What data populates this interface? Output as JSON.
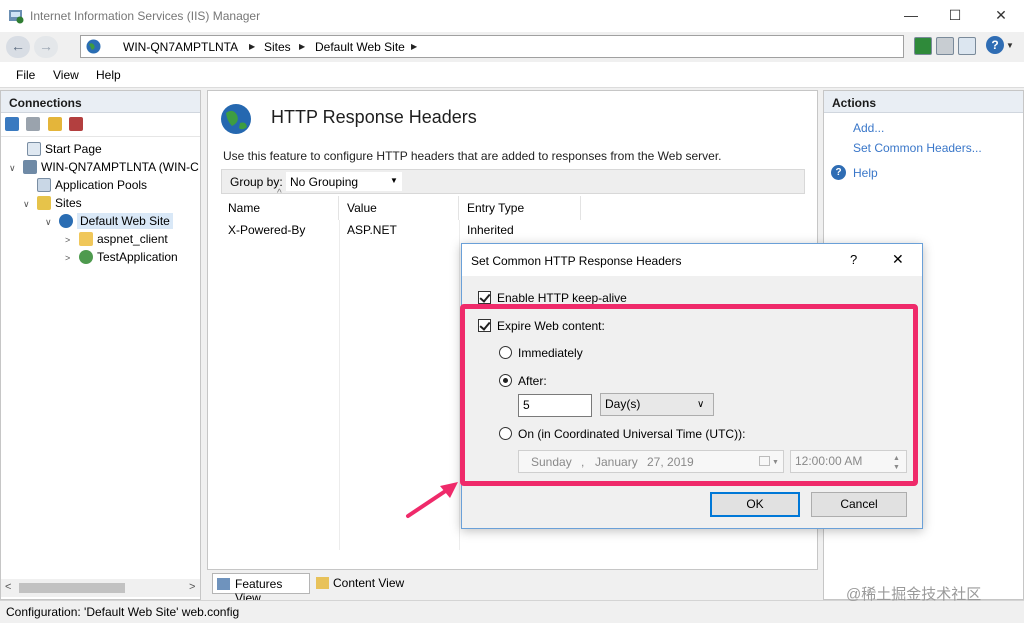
{
  "window": {
    "title": "Internet Information Services (IIS) Manager",
    "controls": {
      "minimize": "—",
      "maximize": "☐",
      "close": "✕"
    }
  },
  "address": {
    "back": "←",
    "forward": "→",
    "crumbs": [
      "WIN-QN7AMPTLNTA",
      "Sites",
      "Default Web Site"
    ],
    "separator": "▶",
    "help": "?"
  },
  "menu": {
    "items": [
      "File",
      "View",
      "Help"
    ]
  },
  "connections": {
    "title": "Connections",
    "tree": [
      {
        "label": "Start Page",
        "level": 0,
        "icon": "start-page-icon"
      },
      {
        "label": "WIN-QN7AMPTLNTA (WIN-C",
        "level": 0,
        "icon": "server-icon",
        "expander": "∨"
      },
      {
        "label": "Application Pools",
        "level": 1,
        "icon": "app-pool-icon"
      },
      {
        "label": "Sites",
        "level": 1,
        "icon": "sites-icon",
        "expander": "∨"
      },
      {
        "label": "Default Web Site",
        "level": 2,
        "icon": "globe-icon",
        "expander": "∨",
        "selected": true
      },
      {
        "label": "aspnet_client",
        "level": 3,
        "icon": "folder-icon",
        "expander": ">"
      },
      {
        "label": "TestApplication",
        "level": 3,
        "icon": "application-icon",
        "expander": ">"
      }
    ],
    "scroll_left": "<",
    "scroll_right": ">"
  },
  "feature": {
    "title": "HTTP Response Headers",
    "description": "Use this feature to configure HTTP headers that are added to responses from the Web server.",
    "group_by_label": "Group by:",
    "group_by_value": "No Grouping",
    "columns": [
      "Name",
      "Value",
      "Entry Type"
    ],
    "rows": [
      {
        "name": "X-Powered-By",
        "value": "ASP.NET",
        "entry_type": "Inherited"
      }
    ],
    "tabs": {
      "features_view": "Features View",
      "content_view": "Content View"
    }
  },
  "actions": {
    "title": "Actions",
    "add": "Add...",
    "set_common": "Set Common Headers...",
    "help": "Help"
  },
  "status": {
    "text": "Configuration: 'Default Web Site' web.config",
    "watermark": "@稀土掘金技术社区"
  },
  "dialog": {
    "title": "Set Common HTTP Response Headers",
    "help": "?",
    "close": "✕",
    "enable_keepalive": "Enable HTTP keep-alive",
    "expire_content": "Expire Web content:",
    "immediately": "Immediately",
    "after": "After:",
    "after_value": "5",
    "after_unit": "Day(s)",
    "on_utc": "On (in Coordinated Universal Time (UTC)):",
    "date_day": "Sunday",
    "date_comma": ",",
    "date_month": "January",
    "date_rest": "27, 2019",
    "time": "12:00:00 AM",
    "ok": "OK",
    "cancel": "Cancel"
  },
  "colors": {
    "highlight": "#ef2a6a",
    "link": "#3a77c9",
    "accent": "#0078d7"
  }
}
